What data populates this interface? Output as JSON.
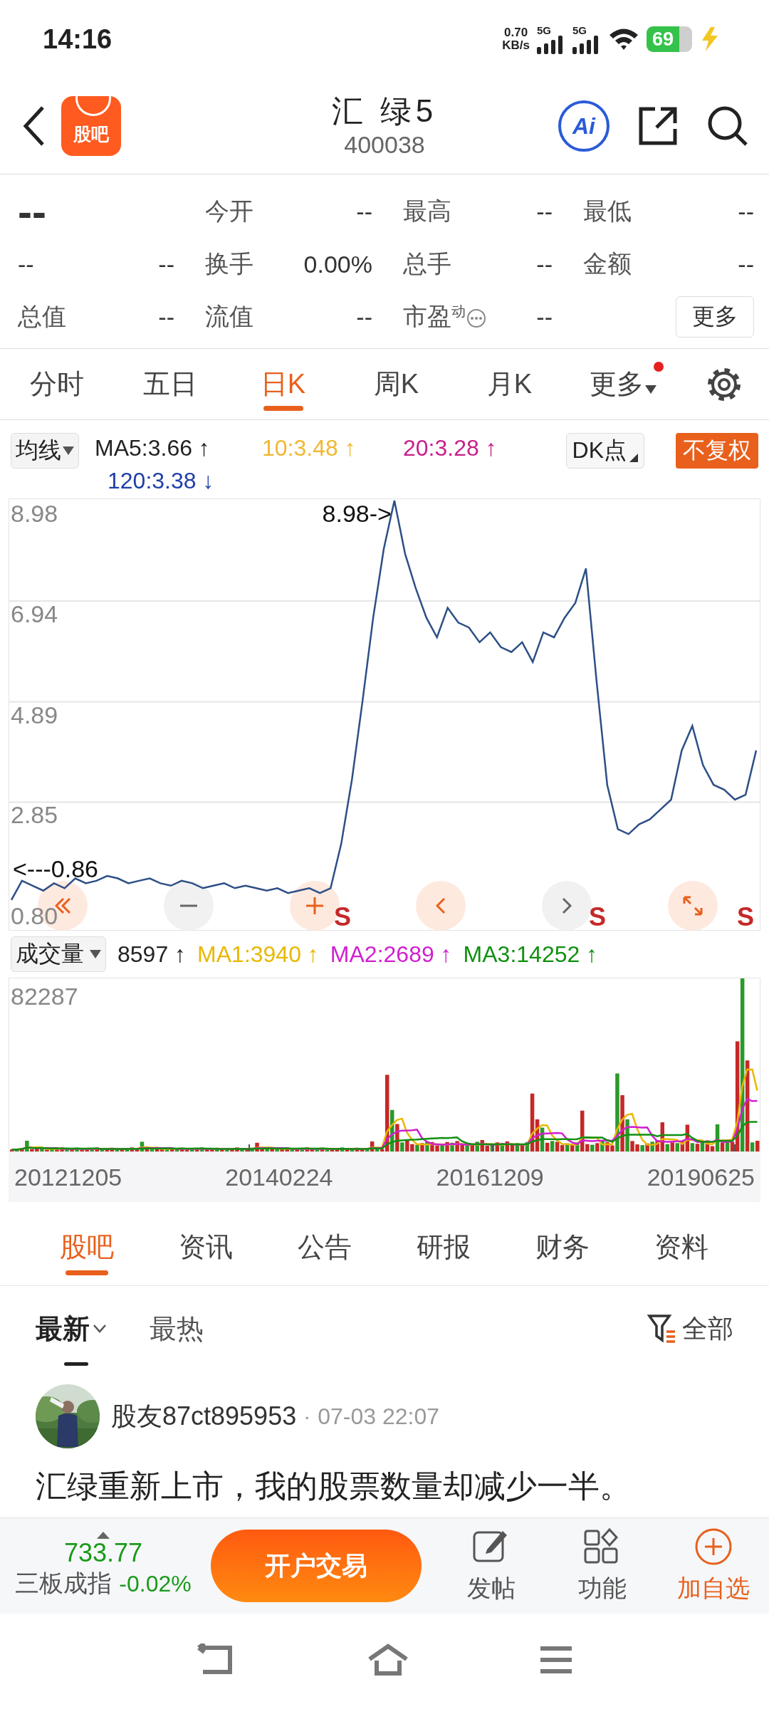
{
  "status_bar": {
    "time": "14:16",
    "net_speed": {
      "value": "0.70",
      "unit": "KB/s"
    },
    "networks": [
      "5G",
      "5G"
    ],
    "battery": "69"
  },
  "header": {
    "logo": "股吧",
    "title": "汇 绿5",
    "code": "400038",
    "ai_button": "Ai"
  },
  "quote": {
    "price": "--",
    "change": "--",
    "change_percent": "--",
    "fields": [
      {
        "label": "今开",
        "value": "--",
        "has_info": false
      },
      {
        "label": "最高",
        "value": "--",
        "has_info": false
      },
      {
        "label": "最低",
        "value": "--",
        "has_info": false
      },
      {
        "label": "换手",
        "value": "0.00%",
        "has_info": false
      },
      {
        "label": "总手",
        "value": "--",
        "has_info": false
      },
      {
        "label": "金额",
        "value": "--",
        "has_info": false
      },
      {
        "label": "总值",
        "value": "--",
        "has_info": false
      },
      {
        "label": "流值",
        "value": "--",
        "has_info": false
      },
      {
        "label": "市盈$^{动}$",
        "value": "--",
        "has_info": true
      }
    ],
    "more_button": "更多"
  },
  "period_tabs": [
    {
      "label": "分时",
      "selected": false,
      "dropdown": false,
      "dot": false
    },
    {
      "label": "五日",
      "selected": false,
      "dropdown": false,
      "dot": false
    },
    {
      "label": "日K",
      "selected": true,
      "dropdown": false,
      "dot": false
    },
    {
      "label": "周K",
      "selected": false,
      "dropdown": false,
      "dot": false
    },
    {
      "label": "月K",
      "selected": false,
      "dropdown": false,
      "dot": false
    },
    {
      "label": "更多",
      "selected": false,
      "dropdown": true,
      "dot": true
    }
  ],
  "ma_legend": {
    "dropdown": "均线",
    "items": [
      {
        "text": "MA5:3.66 ↑",
        "color": "#222222"
      },
      {
        "text": "10:3.48 ↑",
        "color": "#f0b830"
      },
      {
        "text": "20:3.28 ↑",
        "color": "#c8208a"
      },
      {
        "text": "120:3.38 ↓",
        "color": "#1f3fa8"
      }
    ],
    "dk_dropdown": "DK点",
    "adjust_button": "不复权"
  },
  "price_chart": {
    "chart_data": {
      "type": "line",
      "grid": true,
      "ylim": [
        0.25,
        8.98
      ],
      "yticks": [
        {
          "value": 8.98,
          "label": "8.98"
        },
        {
          "value": 6.94,
          "label": "6.94"
        },
        {
          "value": 4.89,
          "label": "4.89"
        },
        {
          "value": 2.85,
          "label": "2.85"
        },
        {
          "value": 0.8,
          "label": "0.80"
        }
      ],
      "series": [
        {
          "color": "#2d4f86",
          "values": [
            0.86,
            1.25,
            1.15,
            1.05,
            1.2,
            1.1,
            1.3,
            1.2,
            1.25,
            1.35,
            1.3,
            1.2,
            1.25,
            1.3,
            1.2,
            1.15,
            1.25,
            1.2,
            1.1,
            1.15,
            1.2,
            1.1,
            1.15,
            1.1,
            1.05,
            1.1,
            1.0,
            1.05,
            1.1,
            1.0,
            1.1,
            2.0,
            3.3,
            4.9,
            6.6,
            8.0,
            8.98,
            7.9,
            7.2,
            6.6,
            6.2,
            6.8,
            6.5,
            6.4,
            6.1,
            6.3,
            6.0,
            5.9,
            6.1,
            5.7,
            6.3,
            6.2,
            6.6,
            6.9,
            7.6,
            5.3,
            3.2,
            2.3,
            2.2,
            2.4,
            2.5,
            2.7,
            2.9,
            3.9,
            4.4,
            3.6,
            3.2,
            3.1,
            2.9,
            3.0,
            3.9
          ]
        }
      ],
      "annotations": [
        "8.98->",
        "<---0.86"
      ]
    },
    "signals": [
      "S",
      "S",
      "S"
    ],
    "controls": [
      {
        "kind": "rewind",
        "enabled": true
      },
      {
        "kind": "zoom_out",
        "enabled": false
      },
      {
        "kind": "zoom_in",
        "enabled": true
      },
      {
        "kind": "previous",
        "enabled": true
      },
      {
        "kind": "next",
        "enabled": false
      },
      {
        "kind": "fullscreen",
        "enabled": true
      }
    ]
  },
  "volume_legend": {
    "dropdown": "成交量",
    "items": [
      {
        "text": "8597 ↑",
        "color": "#222222"
      },
      {
        "text": "MA1:3940 ↑",
        "color": "#e8b800"
      },
      {
        "text": "MA2:2689 ↑",
        "color": "#d020d0"
      },
      {
        "text": "MA3:14252 ↑",
        "color": "#109010"
      }
    ]
  },
  "volume_chart": {
    "max_label": "82287",
    "date_labels": [
      "20121205",
      "20140224",
      "20161209",
      "20190625"
    ]
  },
  "news_tabs": [
    {
      "label": "股吧",
      "selected": true
    },
    {
      "label": "资讯",
      "selected": false
    },
    {
      "label": "公告",
      "selected": false
    },
    {
      "label": "研报",
      "selected": false
    },
    {
      "label": "财务",
      "selected": false
    },
    {
      "label": "资料",
      "selected": false
    }
  ],
  "sort_options": [
    {
      "label": "最新",
      "selected": true,
      "dropdown": true
    },
    {
      "label": "最热",
      "selected": false,
      "dropdown": false
    }
  ],
  "filter": "全部",
  "post": {
    "author": "股友87ct895953",
    "separator": "·",
    "time": "07-03 22:07",
    "text": "汇绿重新上市，我的股票数量却减少一半。"
  },
  "bottom_bar": {
    "index_value": "733.77",
    "index_name": "三板成指",
    "index_change": "-0.02%",
    "trade_button": "开户交易",
    "actions": [
      {
        "label": "发帖",
        "kind": "post",
        "highlighted": false
      },
      {
        "label": "功能",
        "kind": "tools",
        "highlighted": false
      },
      {
        "label": "加自选",
        "kind": "add",
        "highlighted": true
      }
    ]
  }
}
